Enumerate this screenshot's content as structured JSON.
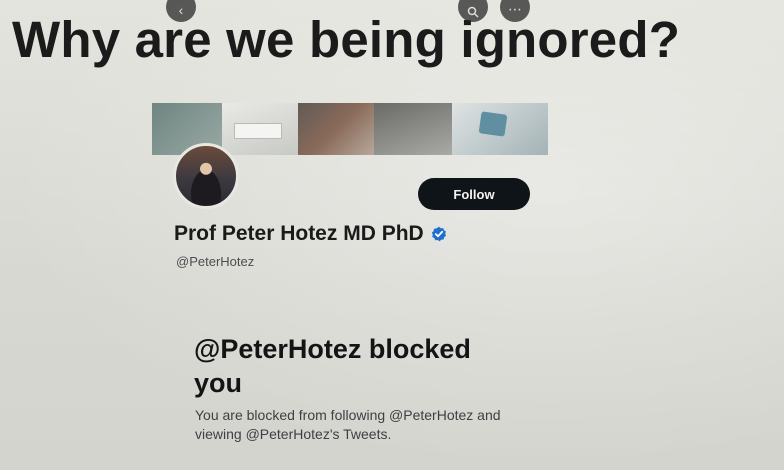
{
  "headline": "Why are we being ignored?",
  "profile": {
    "display_name": "Prof Peter Hotez MD PhD",
    "handle": "@PeterHotez",
    "follow_label": "Follow"
  },
  "blocked_notice": {
    "heading": "@PeterHotez blocked you",
    "body": "You are blocked from following @PeterHotez and viewing @PeterHotez's Tweets."
  },
  "colors": {
    "follow_button": "#0f1419",
    "verified_badge": "#1d6fd0"
  },
  "icons": {
    "back": "arrow-left-icon",
    "search": "search-icon",
    "more": "more-icon",
    "verified": "verified-badge-icon"
  }
}
